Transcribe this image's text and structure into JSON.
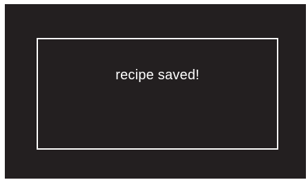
{
  "screen": {
    "background_color": "#231f20"
  },
  "toast": {
    "message": "recipe saved!",
    "border_color": "#ffffff",
    "text_color": "#ffffff"
  }
}
